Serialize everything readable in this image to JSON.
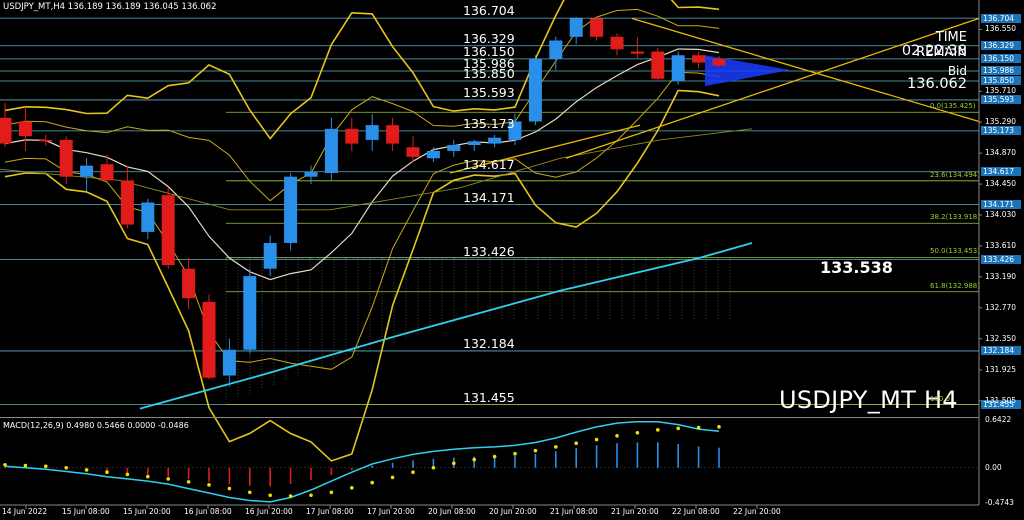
{
  "header": {
    "symbol_info": "USDJPY_MT,H4",
    "ohlc": "136.189 136.189 136.045 136.062"
  },
  "symbol_label": "USDJPY_MT H4",
  "time_remain": {
    "label": "TIME REMAIN",
    "value": "02:22:38"
  },
  "bid": {
    "label": "Bid",
    "value": "136.062"
  },
  "highlight_price": "133.538",
  "levels": [
    {
      "label": "136.704",
      "price": 136.704,
      "axis_tag": "136.704"
    },
    {
      "label": "136.329",
      "price": 136.329,
      "axis_tag": "136.329"
    },
    {
      "label": "136.150",
      "price": 136.15,
      "axis_tag": "136.150"
    },
    {
      "label": "135.986",
      "price": 135.986,
      "axis_tag": "135.986"
    },
    {
      "label": "135.850",
      "price": 135.85,
      "axis_tag": "135.850"
    },
    {
      "label": "135.593",
      "price": 135.593,
      "axis_tag": "135.593"
    },
    {
      "label": "135.173",
      "price": 135.173,
      "axis_tag": "135.173"
    },
    {
      "label": "134.617",
      "price": 134.617,
      "axis_tag": "134.617"
    },
    {
      "label": "134.171",
      "price": 134.171,
      "axis_tag": "134.171"
    },
    {
      "label": "133.426",
      "price": 133.426,
      "axis_tag": "133.426"
    },
    {
      "label": "132.184",
      "price": 132.184,
      "axis_tag": "132.184"
    },
    {
      "label": "131.455",
      "price": 131.455,
      "axis_tag": "131.455"
    }
  ],
  "fib_levels": [
    {
      "label": "0.0(135.425)",
      "price": 135.425
    },
    {
      "label": "23.6(134.494)",
      "price": 134.494
    },
    {
      "label": "38.2(133.918)",
      "price": 133.918
    },
    {
      "label": "50.0(133.453)",
      "price": 133.453
    },
    {
      "label": "61.8(132.988)",
      "price": 132.988
    },
    {
      "label": "100.0",
      "price": 131.455
    }
  ],
  "axis_prices": [
    "136.550",
    "135.710",
    "135.290",
    "134.870",
    "134.450",
    "134.030",
    "133.610",
    "133.190",
    "132.770",
    "132.350",
    "131.925",
    "131.505"
  ],
  "dates": [
    "14 Jun 2022",
    "15 Jun 08:00",
    "15 Jun 20:00",
    "16 Jun 08:00",
    "16 Jun 20:00",
    "17 Jun 08:00",
    "17 Jun 20:00",
    "20 Jun 08:00",
    "20 Jun 20:00",
    "21 Jun 08:00",
    "21 Jun 20:00",
    "22 Jun 08:00",
    "22 Jun 20:00"
  ],
  "macd": {
    "label": "MACD(12,26,9) 0.4980 0.5466 0.0000 -0.0486",
    "ticks": [
      "0.6422",
      "0.00",
      "-0.4743"
    ]
  },
  "chart_data": {
    "type": "candlestick",
    "timeframe": "H4",
    "ylim": [
      131.3,
      136.95
    ],
    "candles": [
      {
        "o": 135.35,
        "h": 135.55,
        "l": 134.95,
        "c": 135.0
      },
      {
        "o": 135.3,
        "h": 135.5,
        "l": 134.9,
        "c": 135.1
      },
      {
        "o": 135.05,
        "h": 135.12,
        "l": 134.97,
        "c": 135.03
      },
      {
        "o": 135.05,
        "h": 135.1,
        "l": 134.45,
        "c": 134.55
      },
      {
        "o": 134.55,
        "h": 134.8,
        "l": 134.35,
        "c": 134.7
      },
      {
        "o": 134.72,
        "h": 134.85,
        "l": 134.48,
        "c": 134.5
      },
      {
        "o": 134.5,
        "h": 134.7,
        "l": 133.85,
        "c": 133.9
      },
      {
        "o": 133.8,
        "h": 134.25,
        "l": 133.7,
        "c": 134.2
      },
      {
        "o": 134.3,
        "h": 134.4,
        "l": 133.3,
        "c": 133.35
      },
      {
        "o": 133.3,
        "h": 133.45,
        "l": 132.75,
        "c": 132.9
      },
      {
        "o": 132.85,
        "h": 132.95,
        "l": 131.8,
        "c": 131.82
      },
      {
        "o": 131.85,
        "h": 132.35,
        "l": 131.7,
        "c": 132.2
      },
      {
        "o": 132.2,
        "h": 133.3,
        "l": 132.15,
        "c": 133.2
      },
      {
        "o": 133.3,
        "h": 133.75,
        "l": 133.2,
        "c": 133.65
      },
      {
        "o": 133.65,
        "h": 134.6,
        "l": 133.55,
        "c": 134.55
      },
      {
        "o": 134.55,
        "h": 134.7,
        "l": 134.45,
        "c": 134.62
      },
      {
        "o": 134.6,
        "h": 135.35,
        "l": 134.5,
        "c": 135.2
      },
      {
        "o": 135.2,
        "h": 135.35,
        "l": 134.9,
        "c": 135.0
      },
      {
        "o": 135.05,
        "h": 135.4,
        "l": 134.9,
        "c": 135.25
      },
      {
        "o": 135.25,
        "h": 135.35,
        "l": 134.9,
        "c": 135.0
      },
      {
        "o": 134.95,
        "h": 135.1,
        "l": 134.75,
        "c": 134.82
      },
      {
        "o": 134.8,
        "h": 134.95,
        "l": 134.75,
        "c": 134.9
      },
      {
        "o": 134.9,
        "h": 135.05,
        "l": 134.82,
        "c": 134.98
      },
      {
        "o": 134.98,
        "h": 135.05,
        "l": 134.9,
        "c": 135.03
      },
      {
        "o": 135.0,
        "h": 135.12,
        "l": 134.95,
        "c": 135.08
      },
      {
        "o": 135.05,
        "h": 135.4,
        "l": 134.98,
        "c": 135.3
      },
      {
        "o": 135.3,
        "h": 136.2,
        "l": 135.25,
        "c": 136.15
      },
      {
        "o": 136.15,
        "h": 136.45,
        "l": 136.0,
        "c": 136.4
      },
      {
        "o": 136.45,
        "h": 136.72,
        "l": 136.35,
        "c": 136.7
      },
      {
        "o": 136.7,
        "h": 136.73,
        "l": 136.4,
        "c": 136.45
      },
      {
        "o": 136.45,
        "h": 136.5,
        "l": 136.2,
        "c": 136.28
      },
      {
        "o": 136.25,
        "h": 136.45,
        "l": 136.15,
        "c": 136.22
      },
      {
        "o": 136.25,
        "h": 136.3,
        "l": 135.85,
        "c": 135.88
      },
      {
        "o": 135.85,
        "h": 136.25,
        "l": 135.8,
        "c": 136.2
      },
      {
        "o": 136.2,
        "h": 136.25,
        "l": 136.02,
        "c": 136.1
      },
      {
        "o": 136.15,
        "h": 136.19,
        "l": 136.04,
        "c": 136.06
      }
    ],
    "macd_histogram": [
      0.02,
      0.0,
      -0.02,
      -0.05,
      -0.08,
      -0.12,
      -0.15,
      -0.18,
      -0.22,
      -0.28,
      -0.34,
      -0.4,
      -0.44,
      -0.46,
      -0.4,
      -0.3,
      -0.18,
      -0.06,
      0.05,
      0.12,
      0.18,
      0.22,
      0.25,
      0.27,
      0.28,
      0.3,
      0.34,
      0.4,
      0.48,
      0.55,
      0.6,
      0.62,
      0.62,
      0.58,
      0.52,
      0.49
    ],
    "macd_signal": [
      0.04,
      0.03,
      0.02,
      0.0,
      -0.03,
      -0.06,
      -0.09,
      -0.12,
      -0.15,
      -0.19,
      -0.23,
      -0.28,
      -0.33,
      -0.37,
      -0.38,
      -0.37,
      -0.33,
      -0.27,
      -0.2,
      -0.13,
      -0.06,
      0.0,
      0.06,
      0.11,
      0.15,
      0.19,
      0.23,
      0.28,
      0.33,
      0.38,
      0.43,
      0.47,
      0.51,
      0.53,
      0.54,
      0.55
    ]
  }
}
